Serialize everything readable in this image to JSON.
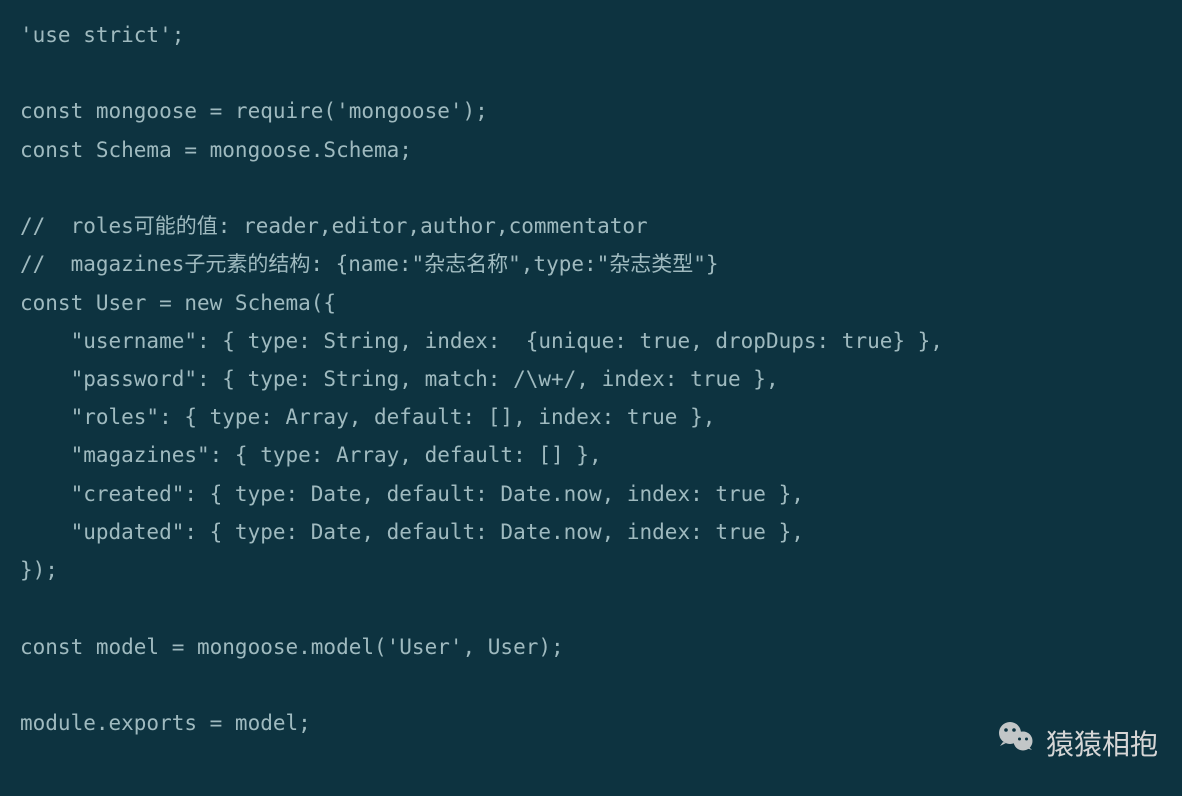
{
  "code": {
    "lines": [
      "'use strict';",
      "",
      "const mongoose = require('mongoose');",
      "const Schema = mongoose.Schema;",
      "",
      "//  roles可能的值: reader,editor,author,commentator",
      "//  magazines子元素的结构: {name:\"杂志名称\",type:\"杂志类型\"}",
      "const User = new Schema({",
      "    \"username\": { type: String, index:  {unique: true, dropDups: true} },",
      "    \"password\": { type: String, match: /\\w+/, index: true },",
      "    \"roles\": { type: Array, default: [], index: true },",
      "    \"magazines\": { type: Array, default: [] },",
      "    \"created\": { type: Date, default: Date.now, index: true },",
      "    \"updated\": { type: Date, default: Date.now, index: true },",
      "});",
      "",
      "const model = mongoose.model('User', User);",
      "",
      "module.exports = model;"
    ]
  },
  "watermark": {
    "text": "猿猿相抱"
  }
}
